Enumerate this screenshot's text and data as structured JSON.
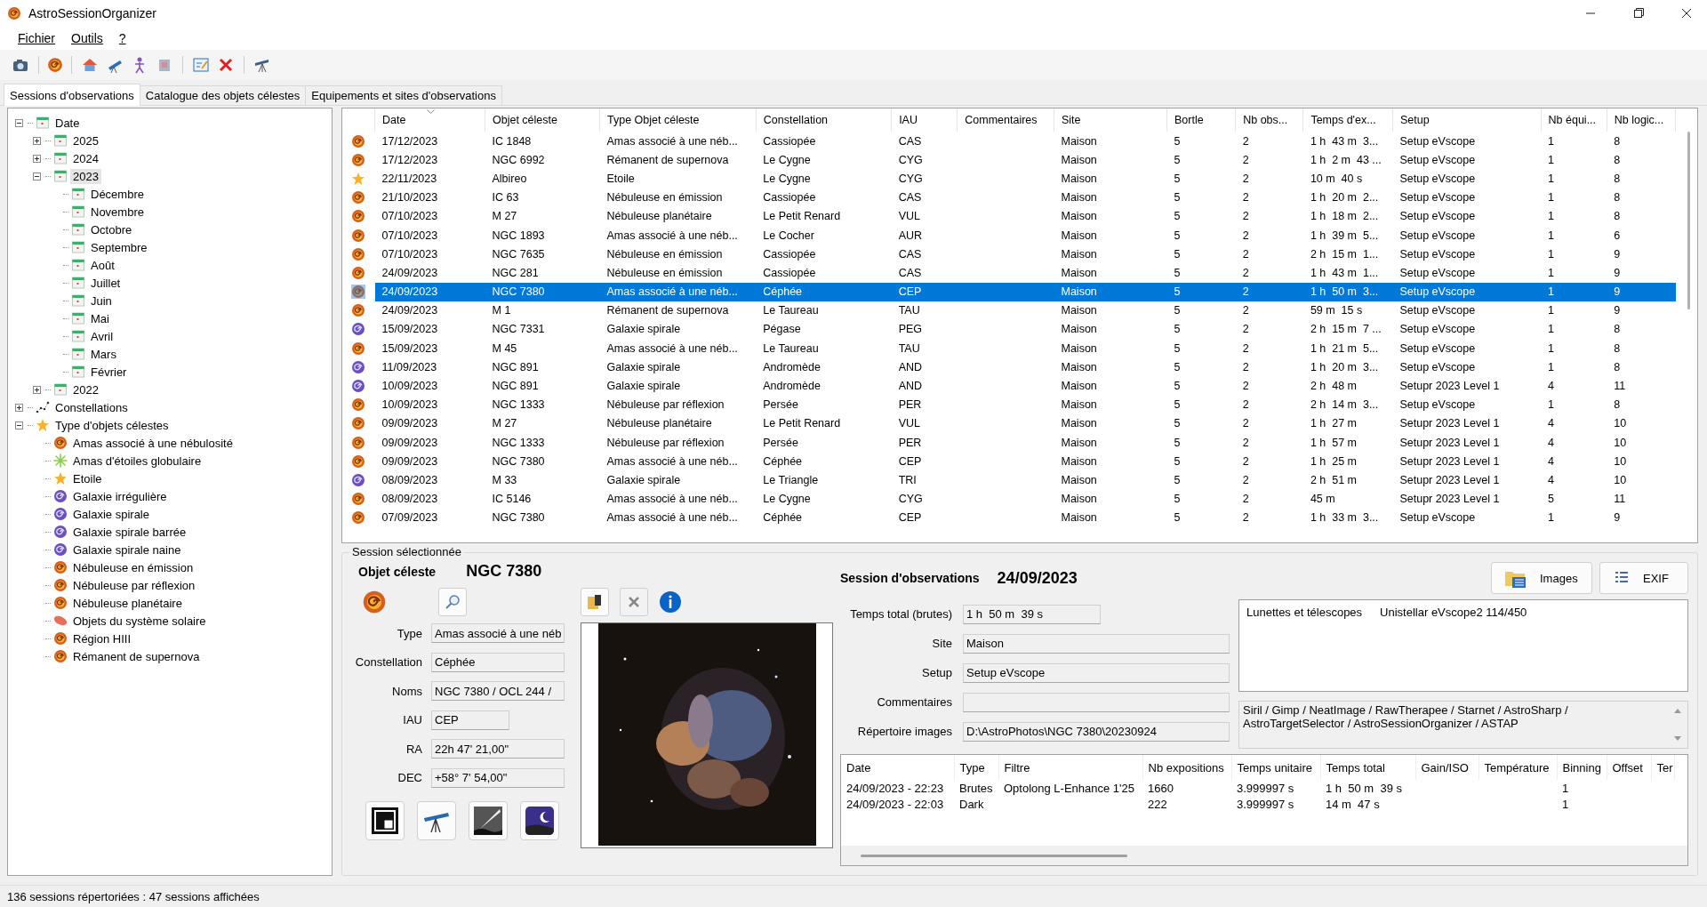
{
  "window": {
    "title": "AstroSessionOrganizer"
  },
  "menu": [
    {
      "label": "Fichier"
    },
    {
      "label": "Outils"
    },
    {
      "label": "?"
    }
  ],
  "tabs": [
    {
      "label": "Sessions d'observations",
      "selected": true
    },
    {
      "label": "Catalogue des objets célestes",
      "selected": false
    },
    {
      "label": "Equipements et sites d'observations",
      "selected": false
    }
  ],
  "tree": [
    {
      "label": "Date",
      "kind": "calendar",
      "expanded": true,
      "selected": false,
      "children": [
        {
          "label": "2025",
          "kind": "calendar",
          "expanded": false,
          "selected": false
        },
        {
          "label": "2024",
          "kind": "calendar",
          "expanded": false,
          "selected": false
        },
        {
          "label": "2023",
          "kind": "calendar",
          "expanded": true,
          "selected": true,
          "children": [
            {
              "label": "Décembre",
              "kind": "calendar",
              "selected": false
            },
            {
              "label": "Novembre",
              "kind": "calendar",
              "selected": false
            },
            {
              "label": "Octobre",
              "kind": "calendar",
              "selected": false
            },
            {
              "label": "Septembre",
              "kind": "calendar",
              "selected": false
            },
            {
              "label": "Août",
              "kind": "calendar",
              "selected": false
            },
            {
              "label": "Juillet",
              "kind": "calendar",
              "selected": false
            },
            {
              "label": "Juin",
              "kind": "calendar",
              "selected": false
            },
            {
              "label": "Mai",
              "kind": "calendar",
              "selected": false
            },
            {
              "label": "Avril",
              "kind": "calendar",
              "selected": false
            },
            {
              "label": "Mars",
              "kind": "calendar",
              "selected": false
            },
            {
              "label": "Février",
              "kind": "calendar",
              "selected": false
            }
          ]
        },
        {
          "label": "2022",
          "kind": "calendar",
          "expanded": false,
          "selected": false
        }
      ]
    },
    {
      "label": "Constellations",
      "kind": "constellation",
      "expanded": false,
      "selected": false
    },
    {
      "label": "Type d'objets célestes",
      "kind": "star",
      "expanded": true,
      "selected": false,
      "children": [
        {
          "label": "Amas associé à une nébulosité",
          "kind": "nebula",
          "selected": false
        },
        {
          "label": "Amas d'étoiles globulaire",
          "kind": "cluster",
          "selected": false
        },
        {
          "label": "Etoile",
          "kind": "star",
          "selected": false
        },
        {
          "label": "Galaxie irrégulière",
          "kind": "galaxy",
          "selected": false
        },
        {
          "label": "Galaxie spirale",
          "kind": "galaxy",
          "selected": false
        },
        {
          "label": "Galaxie spirale barrée",
          "kind": "galaxy",
          "selected": false
        },
        {
          "label": "Galaxie spirale naine",
          "kind": "galaxy",
          "selected": false
        },
        {
          "label": "Nébuleuse en émission",
          "kind": "nebula",
          "selected": false
        },
        {
          "label": "Nébuleuse par réflexion",
          "kind": "nebula",
          "selected": false
        },
        {
          "label": "Nébuleuse planétaire",
          "kind": "nebula",
          "selected": false
        },
        {
          "label": "Objets du système solaire",
          "kind": "planet",
          "selected": false
        },
        {
          "label": "Région HIII",
          "kind": "nebula",
          "selected": false
        },
        {
          "label": "Rémanent de supernova",
          "kind": "nebula",
          "selected": false
        }
      ]
    }
  ],
  "sessions": {
    "columns": [
      "Date",
      "Objet céleste",
      "Type Objet céleste",
      "Constellation",
      "IAU",
      "Commentaires",
      "Site",
      "Bortle",
      "Nb obs...",
      "Temps d'ex...",
      "Setup",
      "Nb équi...",
      "Nb logic..."
    ],
    "rows": [
      {
        "kind": "nebula",
        "selected": false,
        "date": "17/12/2023",
        "object": "IC 1848",
        "type": "Amas associé à une néb...",
        "constellation": "Cassiopée",
        "iau": "CAS",
        "site": "Maison",
        "bortle": "5",
        "observations": "2",
        "exposure": "1 h  43 m  3...",
        "setup": "Setup eVscope",
        "equipment": "1",
        "software": "8"
      },
      {
        "kind": "nebula",
        "selected": false,
        "date": "17/12/2023",
        "object": "NGC 6992",
        "type": "Rémanent de supernova",
        "constellation": "Le Cygne",
        "iau": "CYG",
        "site": "Maison",
        "bortle": "5",
        "observations": "2",
        "exposure": "1 h  2 m  43 ...",
        "setup": "Setup eVscope",
        "equipment": "1",
        "software": "8"
      },
      {
        "kind": "star",
        "selected": false,
        "date": "22/11/2023",
        "object": "Albireo",
        "type": "Etoile",
        "constellation": "Le Cygne",
        "iau": "CYG",
        "site": "Maison",
        "bortle": "5",
        "observations": "2",
        "exposure": "10 m  40 s",
        "setup": "Setup eVscope",
        "equipment": "1",
        "software": "8"
      },
      {
        "kind": "nebula",
        "selected": false,
        "date": "21/10/2023",
        "object": "IC 63",
        "type": "Nébuleuse en émission",
        "constellation": "Cassiopée",
        "iau": "CAS",
        "site": "Maison",
        "bortle": "5",
        "observations": "2",
        "exposure": "1 h  20 m  2...",
        "setup": "Setup eVscope",
        "equipment": "1",
        "software": "8"
      },
      {
        "kind": "nebula",
        "selected": false,
        "date": "07/10/2023",
        "object": "M 27",
        "type": "Nébuleuse planétaire",
        "constellation": "Le Petit Renard",
        "iau": "VUL",
        "site": "Maison",
        "bortle": "5",
        "observations": "2",
        "exposure": "1 h  18 m  2...",
        "setup": "Setup eVscope",
        "equipment": "1",
        "software": "8"
      },
      {
        "kind": "nebula",
        "selected": false,
        "date": "07/10/2023",
        "object": "NGC 1893",
        "type": "Amas associé à une néb...",
        "constellation": "Le Cocher",
        "iau": "AUR",
        "site": "Maison",
        "bortle": "5",
        "observations": "2",
        "exposure": "1 h  39 m  5...",
        "setup": "Setup eVscope",
        "equipment": "1",
        "software": "6"
      },
      {
        "kind": "nebula",
        "selected": false,
        "date": "07/10/2023",
        "object": "NGC 7635",
        "type": "Nébuleuse en émission",
        "constellation": "Cassiopée",
        "iau": "CAS",
        "site": "Maison",
        "bortle": "5",
        "observations": "2",
        "exposure": "2 h  15 m  1...",
        "setup": "Setup eVscope",
        "equipment": "1",
        "software": "9"
      },
      {
        "kind": "nebula",
        "selected": false,
        "date": "24/09/2023",
        "object": "NGC 281",
        "type": "Nébuleuse en émission",
        "constellation": "Cassiopée",
        "iau": "CAS",
        "site": "Maison",
        "bortle": "5",
        "observations": "2",
        "exposure": "1 h  43 m  1...",
        "setup": "Setup eVscope",
        "equipment": "1",
        "software": "9"
      },
      {
        "kind": "nebula",
        "selected": true,
        "date": "24/09/2023",
        "object": "NGC 7380",
        "type": "Amas associé à une néb...",
        "constellation": "Céphée",
        "iau": "CEP",
        "site": "Maison",
        "bortle": "5",
        "observations": "2",
        "exposure": "1 h  50 m  3...",
        "setup": "Setup eVscope",
        "equipment": "1",
        "software": "9"
      },
      {
        "kind": "nebula",
        "selected": false,
        "date": "24/09/2023",
        "object": "M 1",
        "type": "Rémanent de supernova",
        "constellation": "Le Taureau",
        "iau": "TAU",
        "site": "Maison",
        "bortle": "5",
        "observations": "2",
        "exposure": "59 m  15 s",
        "setup": "Setup eVscope",
        "equipment": "1",
        "software": "9"
      },
      {
        "kind": "galaxy",
        "selected": false,
        "date": "15/09/2023",
        "object": "NGC 7331",
        "type": "Galaxie spirale",
        "constellation": "Pégase",
        "iau": "PEG",
        "site": "Maison",
        "bortle": "5",
        "observations": "2",
        "exposure": "2 h  15 m  7 ...",
        "setup": "Setup eVscope",
        "equipment": "1",
        "software": "8"
      },
      {
        "kind": "nebula",
        "selected": false,
        "date": "15/09/2023",
        "object": "M 45",
        "type": "Amas associé à une néb...",
        "constellation": "Le Taureau",
        "iau": "TAU",
        "site": "Maison",
        "bortle": "5",
        "observations": "2",
        "exposure": "1 h  21 m  5...",
        "setup": "Setup eVscope",
        "equipment": "1",
        "software": "8"
      },
      {
        "kind": "galaxy",
        "selected": false,
        "date": "11/09/2023",
        "object": "NGC 891",
        "type": "Galaxie spirale",
        "constellation": "Andromède",
        "iau": "AND",
        "site": "Maison",
        "bortle": "5",
        "observations": "2",
        "exposure": "1 h  20 m  3...",
        "setup": "Setup eVscope",
        "equipment": "1",
        "software": "8"
      },
      {
        "kind": "galaxy",
        "selected": false,
        "date": "10/09/2023",
        "object": "NGC 891",
        "type": "Galaxie spirale",
        "constellation": "Andromède",
        "iau": "AND",
        "site": "Maison",
        "bortle": "5",
        "observations": "2",
        "exposure": "2 h  48 m",
        "setup": "Setupr 2023 Level 1",
        "equipment": "4",
        "software": "11"
      },
      {
        "kind": "nebula",
        "selected": false,
        "date": "10/09/2023",
        "object": "NGC 1333",
        "type": "Nébuleuse par réflexion",
        "constellation": "Persée",
        "iau": "PER",
        "site": "Maison",
        "bortle": "5",
        "observations": "2",
        "exposure": "2 h  14 m  3...",
        "setup": "Setup eVscope",
        "equipment": "1",
        "software": "8"
      },
      {
        "kind": "nebula",
        "selected": false,
        "date": "09/09/2023",
        "object": "M 27",
        "type": "Nébuleuse planétaire",
        "constellation": "Le Petit Renard",
        "iau": "VUL",
        "site": "Maison",
        "bortle": "5",
        "observations": "2",
        "exposure": "1 h  27 m",
        "setup": "Setupr 2023 Level 1",
        "equipment": "4",
        "software": "10"
      },
      {
        "kind": "nebula",
        "selected": false,
        "date": "09/09/2023",
        "object": "NGC 1333",
        "type": "Nébuleuse par réflexion",
        "constellation": "Persée",
        "iau": "PER",
        "site": "Maison",
        "bortle": "5",
        "observations": "2",
        "exposure": "1 h  57 m",
        "setup": "Setupr 2023 Level 1",
        "equipment": "4",
        "software": "10"
      },
      {
        "kind": "nebula",
        "selected": false,
        "date": "09/09/2023",
        "object": "NGC 7380",
        "type": "Amas associé à une néb...",
        "constellation": "Céphée",
        "iau": "CEP",
        "site": "Maison",
        "bortle": "5",
        "observations": "2",
        "exposure": "1 h  25 m",
        "setup": "Setupr 2023 Level 1",
        "equipment": "4",
        "software": "10"
      },
      {
        "kind": "galaxy",
        "selected": false,
        "date": "08/09/2023",
        "object": "M 33",
        "type": "Galaxie spirale",
        "constellation": "Le Triangle",
        "iau": "TRI",
        "site": "Maison",
        "bortle": "5",
        "observations": "2",
        "exposure": "2 h  51 m",
        "setup": "Setupr 2023 Level 1",
        "equipment": "4",
        "software": "10"
      },
      {
        "kind": "nebula",
        "selected": false,
        "date": "08/09/2023",
        "object": "IC 5146",
        "type": "Amas associé à une néb...",
        "constellation": "Le Cygne",
        "iau": "CYG",
        "site": "Maison",
        "bortle": "5",
        "observations": "2",
        "exposure": "45 m",
        "setup": "Setupr 2023 Level 1",
        "equipment": "5",
        "software": "11"
      },
      {
        "kind": "nebula",
        "selected": false,
        "date": "07/09/2023",
        "object": "NGC 7380",
        "type": "Amas associé à une néb...",
        "constellation": "Céphée",
        "iau": "CEP",
        "site": "Maison",
        "bortle": "5",
        "observations": "2",
        "exposure": "1 h  33 m  3...",
        "setup": "Setup eVscope",
        "equipment": "1",
        "software": "9"
      }
    ]
  },
  "selected_session": {
    "group_title": "Session sélectionnée",
    "object_label": "Objet céleste",
    "object_name": "NGC 7380",
    "object_symbol": {
      "kind": "nebula"
    },
    "object_fields": [
      {
        "label": "Type",
        "value": "Amas associé à une néb"
      },
      {
        "label": "Constellation",
        "value": "Céphée"
      },
      {
        "label": "Noms",
        "value": "NGC 7380 / OCL 244 /"
      },
      {
        "label": "IAU",
        "value": "CEP"
      },
      {
        "label": "RA",
        "value": "22h 47' 21,00\""
      },
      {
        "label": "DEC",
        "value": "+58° 7' 54,00\""
      }
    ],
    "session_label": "Session d'observations",
    "session_date": "24/09/2023",
    "buttons": [
      {
        "label": "Images"
      },
      {
        "label": "EXIF"
      }
    ],
    "session_fields": [
      {
        "label": "Temps total (brutes)",
        "value": "1 h  50 m  39 s"
      },
      {
        "label": "Site",
        "value": "Maison"
      },
      {
        "label": "Setup",
        "value": "Setup eVscope"
      },
      {
        "label": "Commentaires"
      },
      {
        "label": "Répertoire images",
        "value": "D:\\AstroPhotos\\NGC 7380\\20230924"
      }
    ],
    "equipment": {
      "category": "Lunettes et télescopes",
      "value": "Unistellar eVscope2 114/450"
    },
    "software": "Siril / Gimp / NeatImage / RawTherapee / Starnet / AstroSharp / AstroTargetSelector / AstroSessionOrganizer / ASTAP",
    "exposures": {
      "columns": [
        "Date",
        "Type",
        "Filtre",
        "Nb expositions",
        "Temps unitaire",
        "Temps total",
        "Gain/ISO",
        "Température",
        "Binning",
        "Offset",
        "Ter"
      ],
      "rows": [
        [
          "24/09/2023 - 22:23",
          "Brutes",
          "Optolong L-Enhance 1'25",
          "1660",
          "3.999997 s",
          "1 h  50 m  39 s",
          "",
          "",
          "1"
        ],
        [
          "24/09/2023 - 22:03",
          "Dark",
          "",
          "222",
          "3.999997 s",
          "14 m  47 s",
          "",
          "",
          "1"
        ]
      ]
    }
  },
  "status_bar": "136 sessions répertoriées : 47 sessions affichées"
}
